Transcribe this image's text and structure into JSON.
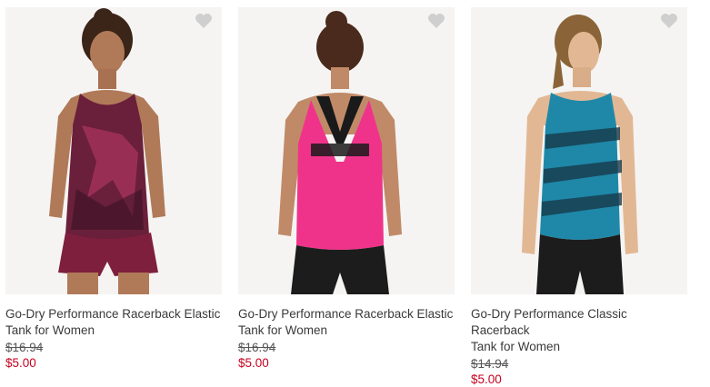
{
  "icons": {
    "favorite": "heart-icon"
  },
  "colors": {
    "sale_price": "#c8001e",
    "heart": "#cfcfcf"
  },
  "products": [
    {
      "title_line1": "Go-Dry Performance Racerback Elastic",
      "title_line2": "Tank for Women",
      "original_price": "$16.94",
      "sale_price": "$5.00"
    },
    {
      "title_line1": "Go-Dry Performance Racerback Elastic",
      "title_line2": "Tank for Women",
      "original_price": "$16.94",
      "sale_price": "$5.00"
    },
    {
      "title_line1": "Go-Dry Performance Classic Racerback",
      "title_line2": "Tank for Women",
      "original_price": "$14.94",
      "sale_price": "$5.00"
    }
  ]
}
